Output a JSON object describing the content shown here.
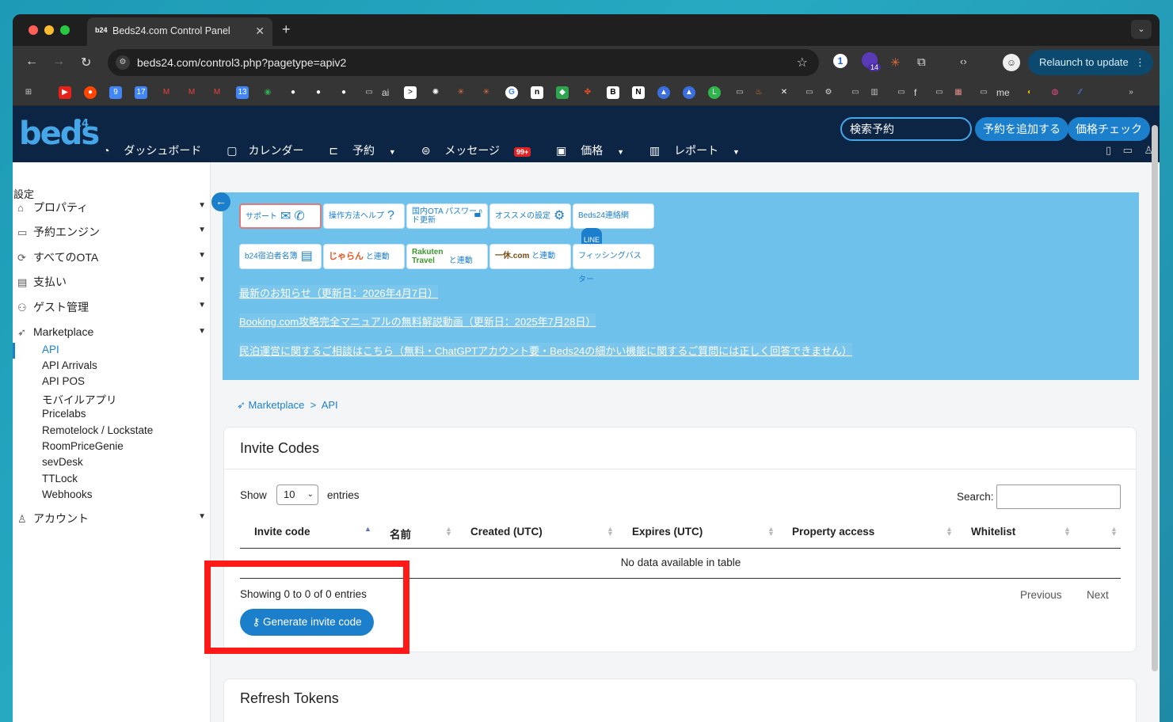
{
  "browser": {
    "tab_title": "Beds24.com Control Panel",
    "tab_favicon_text": "b24",
    "url": "beds24.com/control3.php?pagetype=apiv2",
    "relaunch_label": "Relaunch to update",
    "extension_badge": "14",
    "bookmarks": [
      {
        "label": "ai"
      },
      {
        "label": "f"
      },
      {
        "label": "me"
      }
    ]
  },
  "header": {
    "logo_text": "beds",
    "logo_sup": "24",
    "nav": [
      {
        "label": "ダッシュボード",
        "icon": "gauge-icon"
      },
      {
        "label": "カレンダー",
        "icon": "calendar-icon"
      },
      {
        "label": "予約",
        "icon": "bed-icon"
      },
      {
        "label": "メッセージ",
        "icon": "inbox-icon",
        "badge": "99+"
      },
      {
        "label": "価格",
        "icon": "money-icon"
      },
      {
        "label": "レポート",
        "icon": "chart-icon"
      }
    ],
    "search_placeholder": "検索予約",
    "add_booking": "予約を追加する",
    "price_check": "価格チェック"
  },
  "sidebar": {
    "heading": "設定",
    "items": [
      {
        "label": "プロパティ",
        "icon": "home-icon"
      },
      {
        "label": "予約エンジン",
        "icon": "monitor-icon"
      },
      {
        "label": "すべてのOTA",
        "icon": "sync-icon"
      },
      {
        "label": "支払い",
        "icon": "card-icon"
      },
      {
        "label": "ゲスト管理",
        "icon": "people-icon"
      },
      {
        "label": "Marketplace",
        "icon": "rocket-icon"
      }
    ],
    "marketplace_sub": [
      "API",
      "API Arrivals",
      "API POS",
      "モバイルアプリ",
      "Pricelabs",
      "Remotelock / Lockstate",
      "RoomPriceGenie",
      "sevDesk",
      "TTLock",
      "Webhooks"
    ],
    "account": {
      "label": "アカウント",
      "icon": "user-icon"
    }
  },
  "info": {
    "buttons_row1": [
      "サポート",
      "操作方法ヘルプ",
      "国内OTA パスワード更新",
      "オススメの設定",
      "Beds24連絡網"
    ],
    "buttons_row2": [
      "b24宿泊者名簿",
      "と連動",
      "と連動",
      "と連動",
      "フィッシングバスター"
    ],
    "row2_brands": [
      "じゃらん",
      "Rakuten Travel",
      "一休.com"
    ],
    "notices": [
      "最新のお知らせ（更新日：2026年4月7日）",
      "Booking.com攻略完全マニュアルの無料解説動画（更新日：2025年7月28日）",
      "民泊運営に関するご相談はこちら（無料・ChatGPTアカウント要・Beds24の細かい機能に関するご質問には正しく回答できません）"
    ]
  },
  "breadcrumb": {
    "parent": "Marketplace",
    "sep": ">",
    "current": "API"
  },
  "invite_card": {
    "title": "Invite Codes",
    "show_label": "Show",
    "entries_value": "10",
    "entries_label": "entries",
    "search_label": "Search:",
    "columns": [
      "Invite code",
      "名前",
      "Created (UTC)",
      "Expires (UTC)",
      "Property access",
      "Whitelist"
    ],
    "empty_text": "No data available in table",
    "showing_text": "Showing 0 to 0 of 0 entries",
    "prev_label": "Previous",
    "next_label": "Next",
    "generate_label": "Generate invite code"
  },
  "refresh_card": {
    "title": "Refresh Tokens"
  }
}
